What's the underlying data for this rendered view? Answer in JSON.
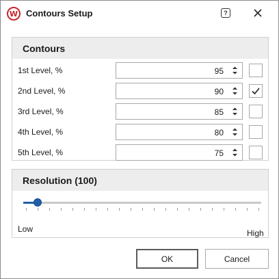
{
  "window": {
    "title": "Contours Setup",
    "app_icon_letter": "W",
    "help_glyph": "?"
  },
  "contours": {
    "title": "Contours",
    "levels": [
      {
        "label": "1st Level, %",
        "value": "95",
        "checked": false
      },
      {
        "label": "2nd Level, %",
        "value": "90",
        "checked": true
      },
      {
        "label": "3rd Level, %",
        "value": "85",
        "checked": false
      },
      {
        "label": "4th Level, %",
        "value": "80",
        "checked": false
      },
      {
        "label": "5th Level, %",
        "value": "75",
        "checked": false
      }
    ]
  },
  "resolution": {
    "title": "Resolution (100)",
    "slider_fraction": 0.06,
    "low_label": "Low",
    "high_label": "High"
  },
  "buttons": {
    "ok": "OK",
    "cancel": "Cancel"
  },
  "colors": {
    "accent": "#1f5fa8",
    "brand": "#c8262c"
  }
}
